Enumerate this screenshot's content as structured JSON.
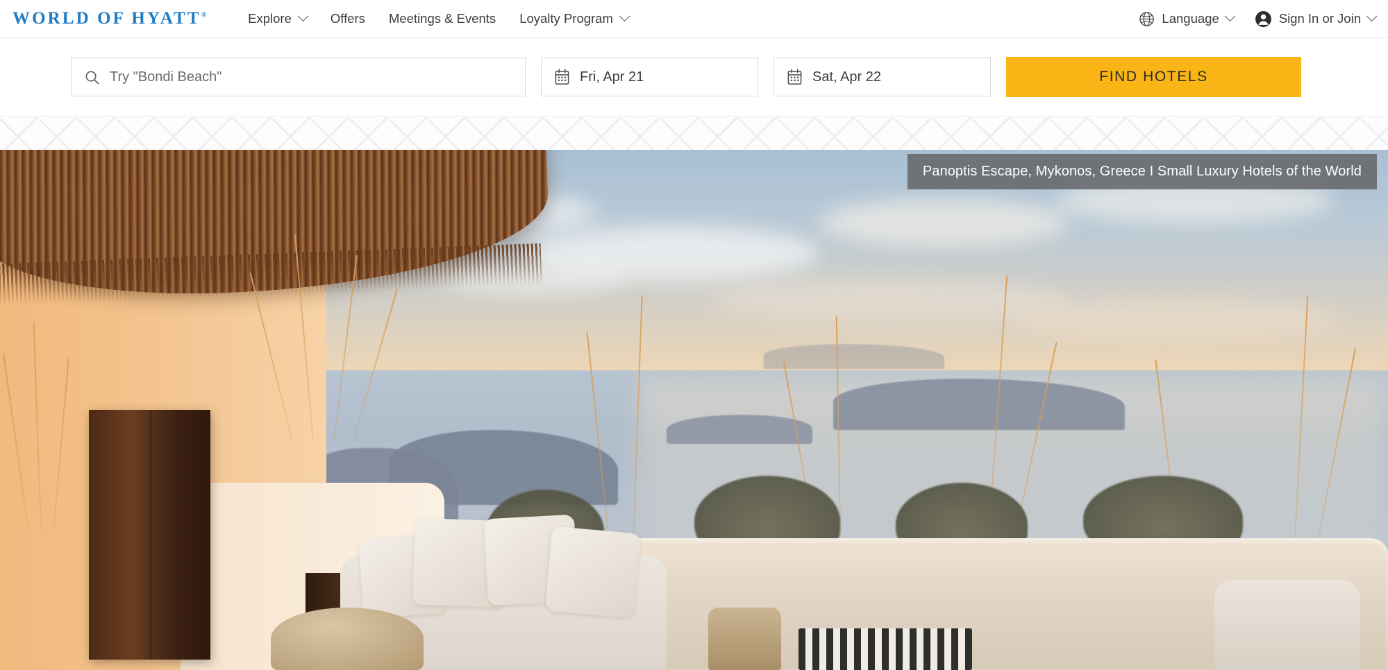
{
  "brand": {
    "logo_text": "WORLD OF HYATT",
    "logo_trademark": "®",
    "logo_color": "#1e7bc4"
  },
  "nav": {
    "items": [
      {
        "label": "Explore",
        "has_chevron": true
      },
      {
        "label": "Offers",
        "has_chevron": false
      },
      {
        "label": "Meetings & Events",
        "has_chevron": false
      },
      {
        "label": "Loyalty Program",
        "has_chevron": true
      }
    ],
    "right": {
      "language": {
        "label": "Language",
        "icon": "globe-icon",
        "has_chevron": true
      },
      "account": {
        "label": "Sign In or Join",
        "icon": "user-avatar-icon",
        "has_chevron": true
      }
    }
  },
  "search": {
    "destination_placeholder": "Try \"Bondi Beach\"",
    "destination_value": "",
    "destination_icon": "search-icon",
    "check_in": {
      "value": "Fri, Apr 21",
      "icon": "calendar-icon"
    },
    "check_out": {
      "value": "Sat, Apr 22",
      "icon": "calendar-icon"
    },
    "submit_label": "FIND HOTELS",
    "submit_color": "#f9b416"
  },
  "hero": {
    "caption": "Panoptis Escape, Mykonos, Greece I Small Luxury Hotels of the World",
    "caption_bg": "#65686b",
    "alt": "Terrace with white sofa overlooking the Aegean Sea at sunset"
  }
}
